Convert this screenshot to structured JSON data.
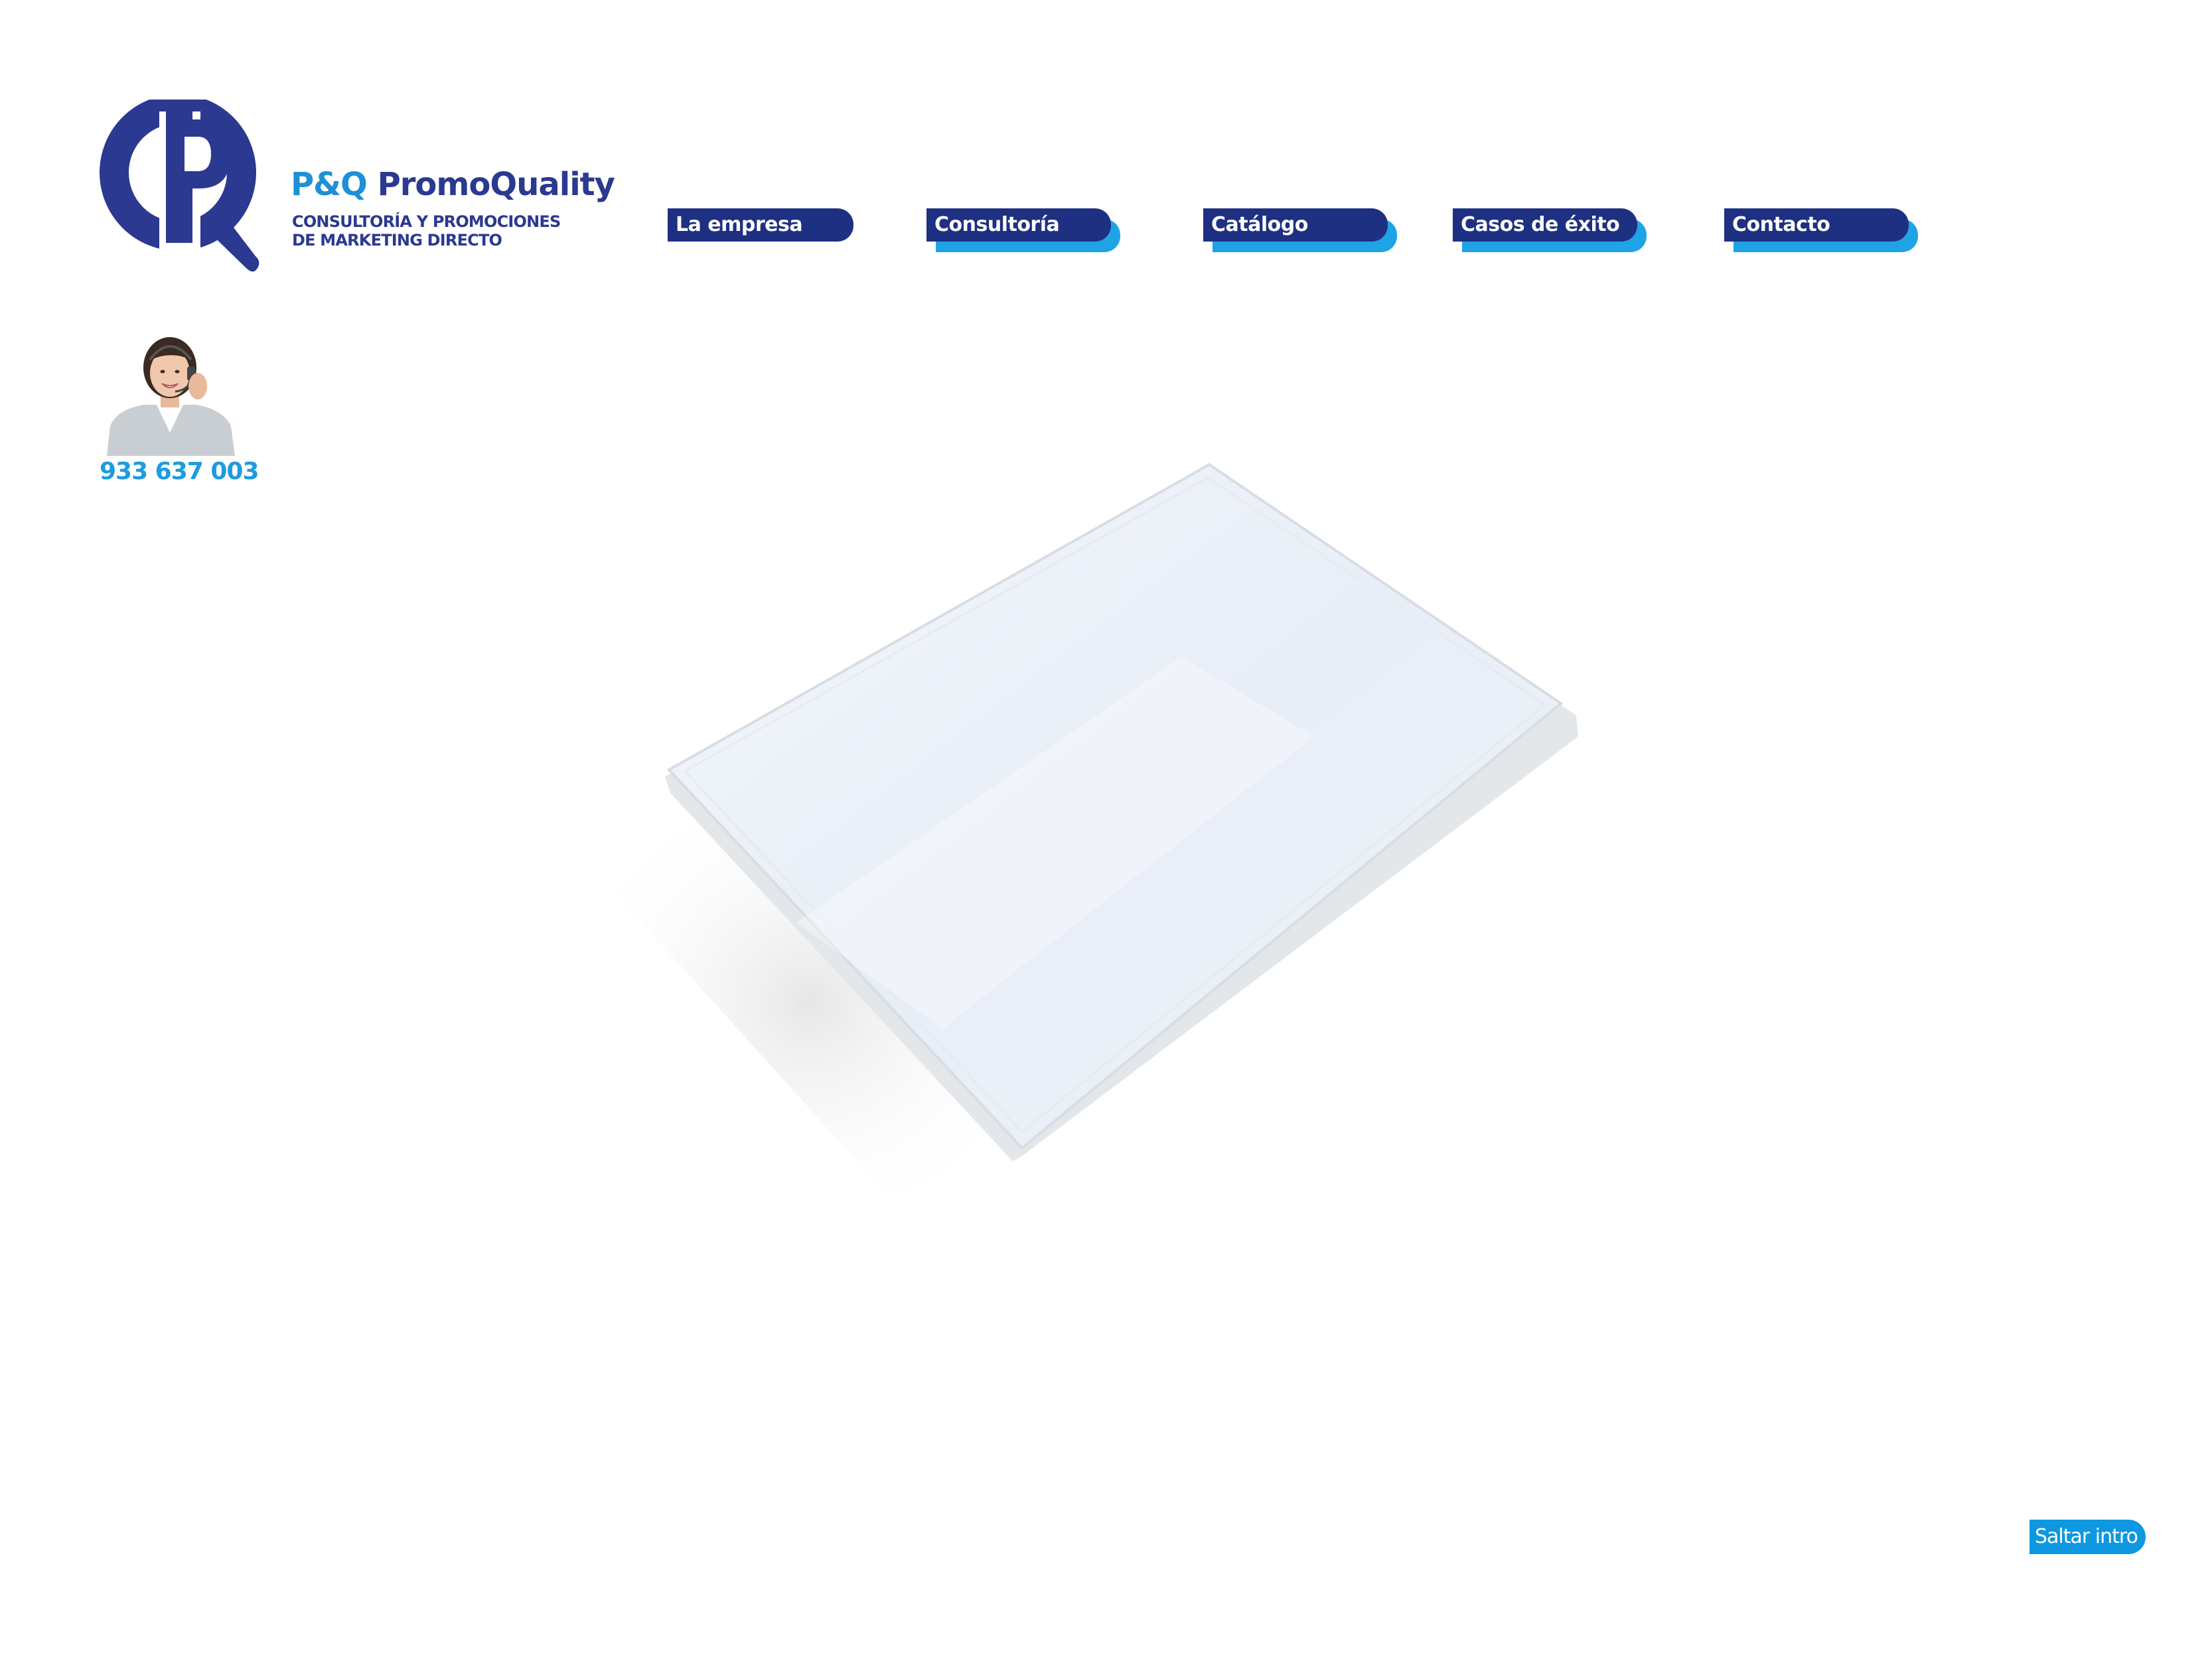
{
  "brand": {
    "name_part1": "P&Q",
    "name_part2": "PromoQuality",
    "tagline_line1": "CONSULTORÍA Y PROMOCIONES",
    "tagline_line2": "DE MARKETING DIRECTO",
    "logo_letters": "PQ"
  },
  "nav": {
    "items": [
      {
        "label": "La empresa"
      },
      {
        "label": "Consultoría"
      },
      {
        "label": "Catálogo"
      },
      {
        "label": "Casos de éxito"
      },
      {
        "label": "Contacto"
      }
    ]
  },
  "contact": {
    "phone": "933 637 003",
    "photo_icon": "call-center-agent-icon"
  },
  "hero": {
    "product_icon": "blank-dvd-case-image"
  },
  "skip": {
    "label": "Saltar intro"
  },
  "colors": {
    "navy": "#1d3082",
    "brand_navy": "#2b3990",
    "light_blue": "#1ea4e6",
    "phone_blue": "#1e9be0",
    "skip_blue": "#0d98e0",
    "background": "#ffffff"
  }
}
